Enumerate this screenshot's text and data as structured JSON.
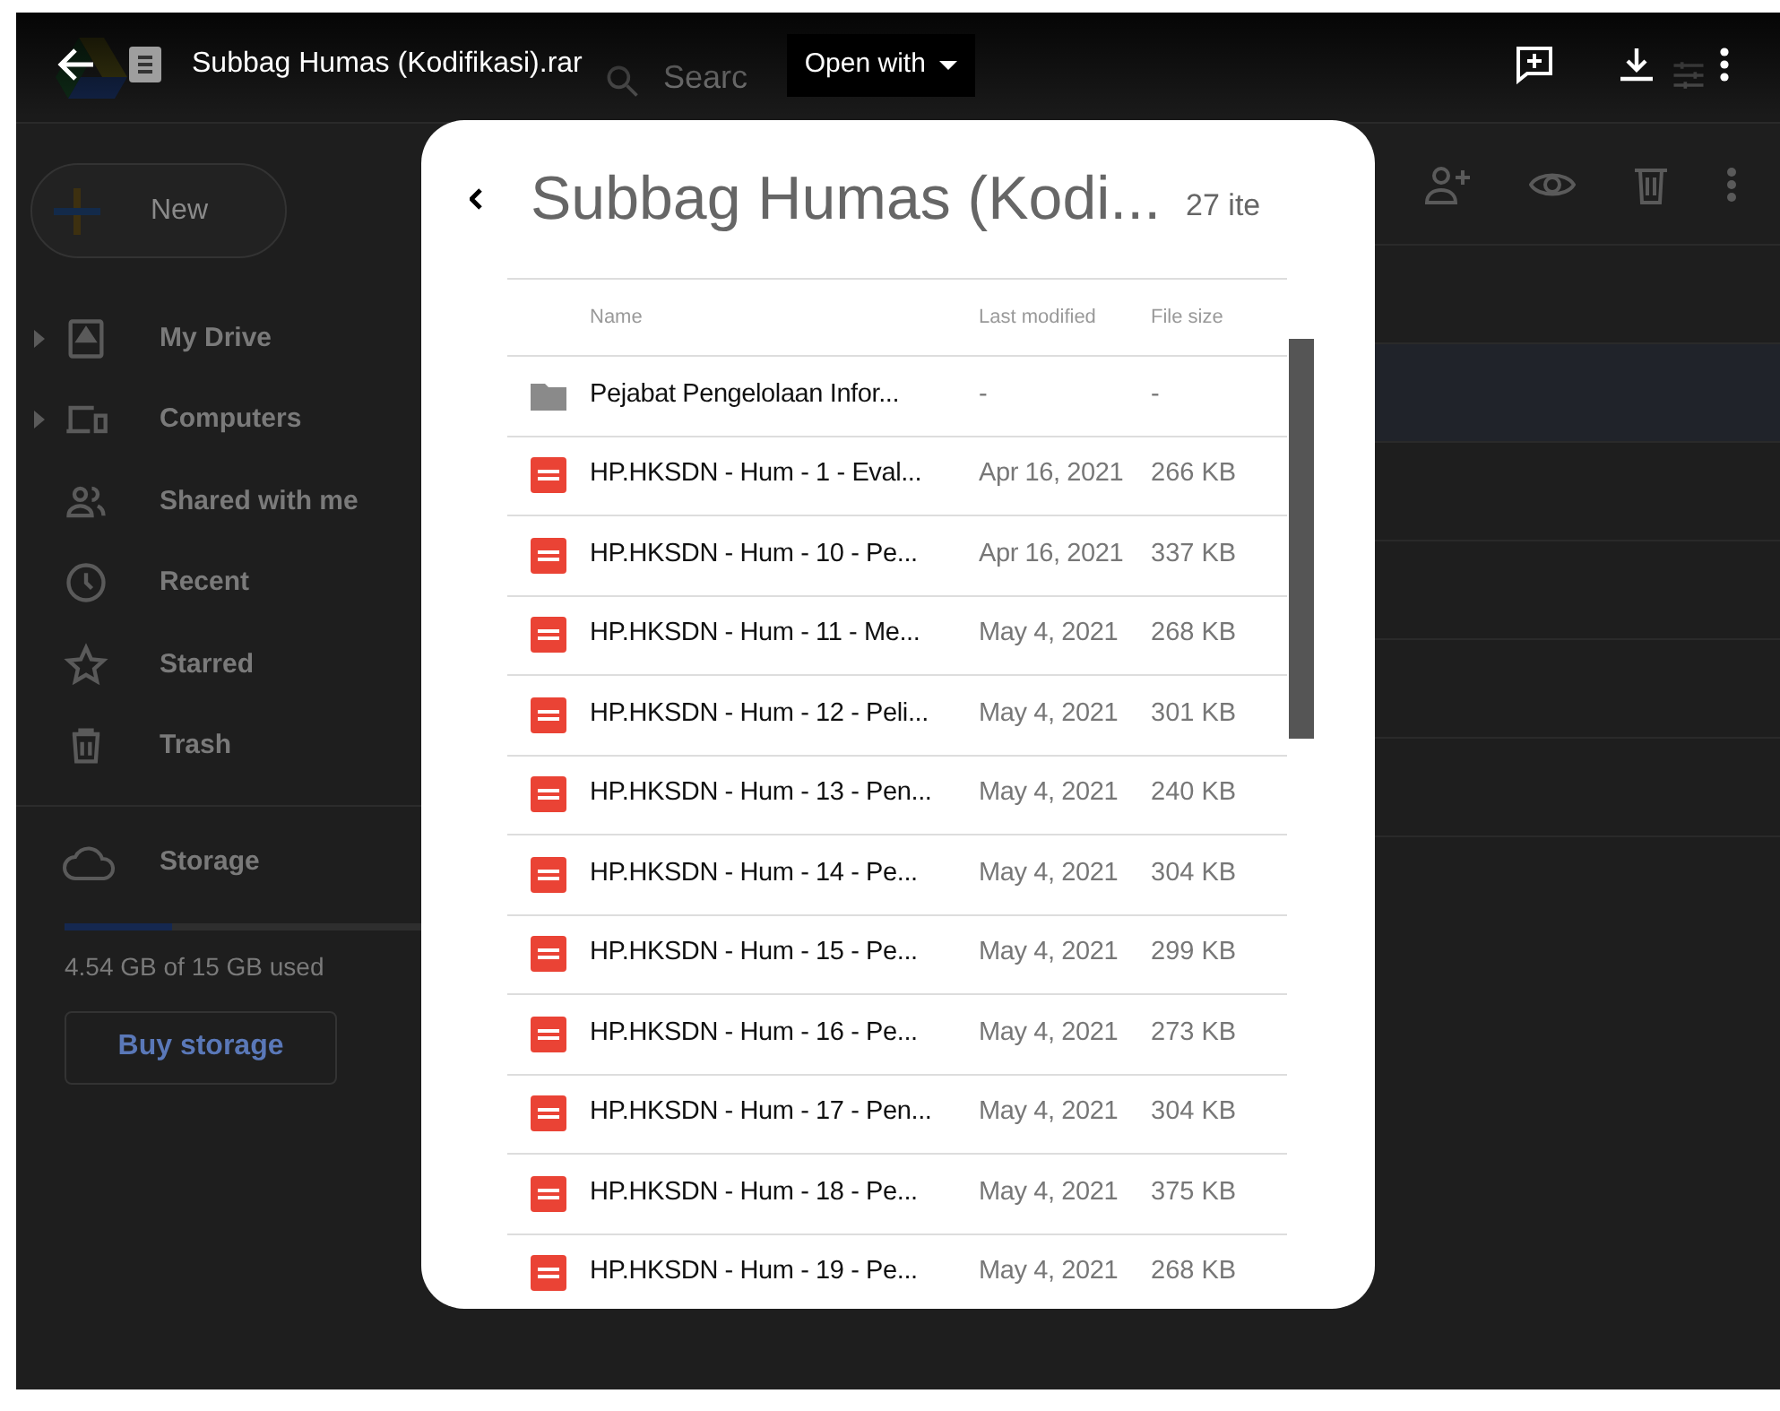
{
  "viewer_bar": {
    "title": "Subbag Humas (Kodifikasi).rar",
    "open_with": "Open with"
  },
  "drive": {
    "search_text": "Searc",
    "new_button": "New",
    "sidebar": [
      {
        "label": "My Drive",
        "expandable": true
      },
      {
        "label": "Computers",
        "expandable": true
      },
      {
        "label": "Shared with me",
        "expandable": false
      },
      {
        "label": "Recent",
        "expandable": false
      },
      {
        "label": "Starred",
        "expandable": false
      },
      {
        "label": "Trash",
        "expandable": false
      }
    ],
    "storage": {
      "label": "Storage",
      "level": 0.3,
      "usage": "4.54 GB of 15 GB used",
      "buy": "Buy storage"
    }
  },
  "archive": {
    "title": "Subbag Humas (Kodi...",
    "count": "27 ite",
    "columns": [
      "Name",
      "Last modified",
      "File size"
    ],
    "rows": [
      {
        "kind": "folder",
        "name": "Pejabat Pengelolaan Infor...",
        "modified": "-",
        "size": "-"
      },
      {
        "kind": "pdf",
        "name": "HP.HKSDN - Hum - 1 - Eval...",
        "modified": "Apr 16, 2021",
        "size": "266 KB"
      },
      {
        "kind": "pdf",
        "name": "HP.HKSDN - Hum - 10 - Pe...",
        "modified": "Apr 16, 2021",
        "size": "337 KB"
      },
      {
        "kind": "pdf",
        "name": "HP.HKSDN - Hum - 11 - Me...",
        "modified": "May 4, 2021",
        "size": "268 KB"
      },
      {
        "kind": "pdf",
        "name": "HP.HKSDN - Hum - 12 - Peli...",
        "modified": "May 4, 2021",
        "size": "301 KB"
      },
      {
        "kind": "pdf",
        "name": "HP.HKSDN - Hum - 13 - Pen...",
        "modified": "May 4, 2021",
        "size": "240 KB"
      },
      {
        "kind": "pdf",
        "name": "HP.HKSDN - Hum - 14 - Pe...",
        "modified": "May 4, 2021",
        "size": "304 KB"
      },
      {
        "kind": "pdf",
        "name": "HP.HKSDN - Hum - 15 - Pe...",
        "modified": "May 4, 2021",
        "size": "299 KB"
      },
      {
        "kind": "pdf",
        "name": "HP.HKSDN - Hum - 16 - Pe...",
        "modified": "May 4, 2021",
        "size": "273 KB"
      },
      {
        "kind": "pdf",
        "name": "HP.HKSDN - Hum - 17 - Pen...",
        "modified": "May 4, 2021",
        "size": "304 KB"
      },
      {
        "kind": "pdf",
        "name": "HP.HKSDN - Hum - 18 - Pe...",
        "modified": "May 4, 2021",
        "size": "375 KB"
      },
      {
        "kind": "pdf",
        "name": "HP.HKSDN - Hum - 19 - Pe...",
        "modified": "May 4, 2021",
        "size": "268 KB"
      }
    ]
  }
}
